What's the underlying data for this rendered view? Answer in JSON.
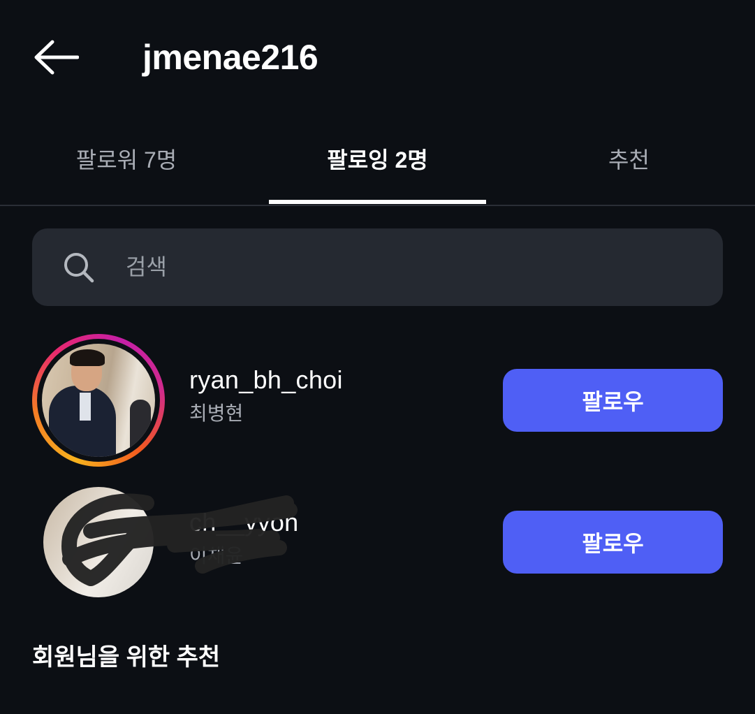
{
  "header": {
    "title": "jmenae216",
    "back_icon": "arrow-left-icon"
  },
  "tabs": [
    {
      "label": "팔로워 7명",
      "active": false
    },
    {
      "label": "팔로잉 2명",
      "active": true
    },
    {
      "label": "추천",
      "active": false
    }
  ],
  "search": {
    "placeholder": "검색",
    "icon": "search-icon"
  },
  "following": [
    {
      "username": "ryan_bh_choi",
      "full_name": "최병현",
      "button_label": "팔로우",
      "has_story_ring": true
    },
    {
      "username": "ch__yyon",
      "full_name": "이채윤",
      "button_label": "팔로우",
      "has_story_ring": false,
      "redacted": true
    }
  ],
  "suggestions": {
    "title": "회원님을 위한 추천"
  },
  "colors": {
    "background": "#0c0f14",
    "search_bg": "#252931",
    "follow_button": "#4f5ff5",
    "secondary_text": "#a9adb5"
  }
}
